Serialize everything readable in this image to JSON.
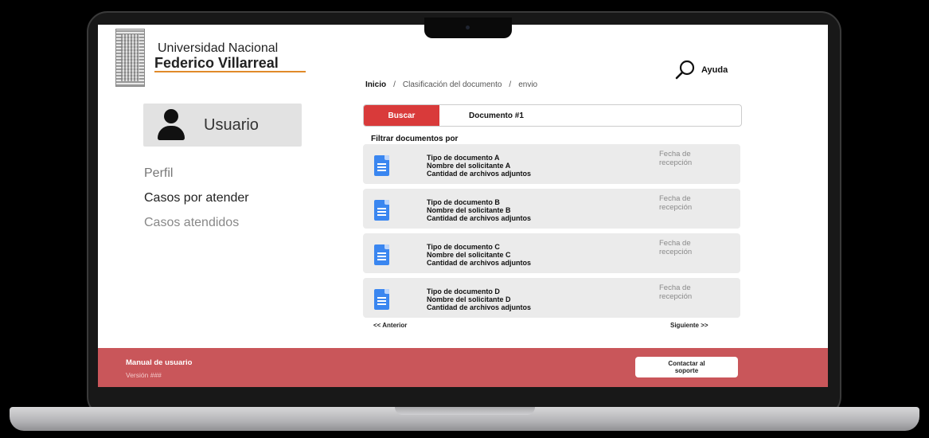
{
  "header": {
    "university_line1": "Universidad Nacional",
    "university_line2": "Federico Villarreal",
    "help_label": "Ayuda"
  },
  "breadcrumb": [
    "Inicio",
    "/",
    "Clasificación del documento",
    "/",
    "envio"
  ],
  "user": {
    "name": "Usuario"
  },
  "sidebar": {
    "items": [
      {
        "label": "Perfil"
      },
      {
        "label": "Casos por atender"
      },
      {
        "label": "Casos atendidos"
      }
    ]
  },
  "search": {
    "button_label": "Buscar",
    "value": "Documento #1"
  },
  "filter_label": "Filtrar documentos por",
  "documents": [
    {
      "type": "Tipo de documento A",
      "applicant": "Nombre del solicitante A",
      "attachments": "Cantidad de archivos adjuntos",
      "date_line1": "Fecha de",
      "date_line2": "recepción"
    },
    {
      "type": "Tipo de documento B",
      "applicant": "Nombre del solicitante B",
      "attachments": "Cantidad de archivos adjuntos",
      "date_line1": "Fecha de",
      "date_line2": "recepción"
    },
    {
      "type": "Tipo de documento C",
      "applicant": "Nombre del solicitante C",
      "attachments": "Cantidad de archivos adjuntos",
      "date_line1": "Fecha de",
      "date_line2": "recepción"
    },
    {
      "type": "Tipo de documento D",
      "applicant": "Nombre del solicitante D",
      "attachments": "Cantidad de archivos adjuntos",
      "date_line1": "Fecha de",
      "date_line2": "recepción"
    }
  ],
  "pagination": {
    "prev": "<< Anterior",
    "next": "Siguiente >>"
  },
  "footer": {
    "manual": "Manual de usuario",
    "version": "Versión ###",
    "support_line1": "Contactar al",
    "support_line2": "soporte"
  },
  "colors": {
    "accent_red": "#d93a3a",
    "footer_red": "#c9565a",
    "logo_underline": "#e08a2a",
    "doc_icon_blue": "#3a86f0"
  }
}
